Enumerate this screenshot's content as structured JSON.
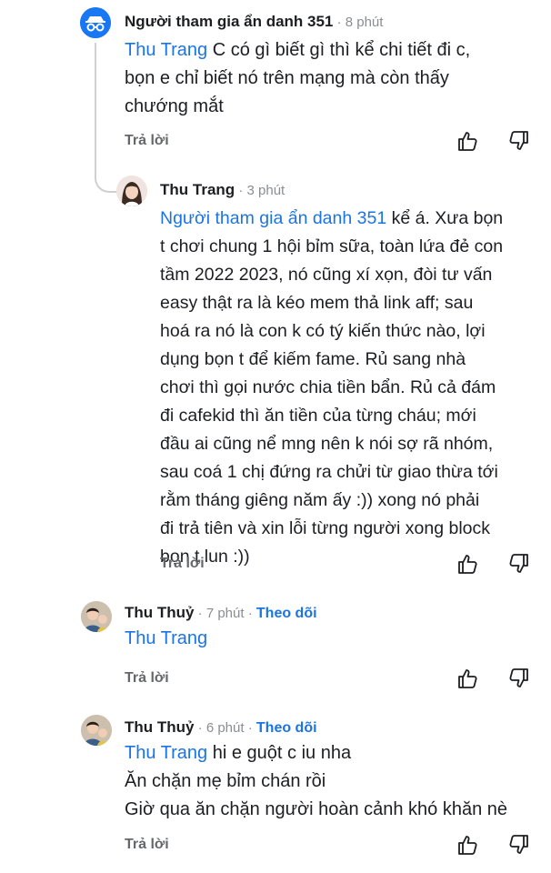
{
  "comments": [
    {
      "author": "Người tham gia ẩn danh 351",
      "time": "8 phút",
      "mention": "Thu Trang",
      "lines": [
        " C có gì biết gì thì kể chi tiết đi c,",
        "bọn e chỉ biết nó trên mạng mà còn thấy",
        "chướng mắt"
      ],
      "reply_label": "Trả lời",
      "avatar_icon": "anonymous-avatar-icon"
    },
    {
      "author": "Thu Trang",
      "time": "3 phút",
      "mention": "Người tham gia ẩn danh 351",
      "lines": [
        " kể á. Xưa bọn",
        "t chơi chung 1 hội bỉm sữa, toàn lứa đẻ con",
        "tầm 2022 2023, nó cũng xí xọn, đòi tư vấn",
        "easy thật ra là kéo mem thả link aff; sau",
        "hoá ra nó là con k có tý kiến thức nào, lợi",
        "dụng bọn t để kiếm fame. Rủ sang nhà",
        "chơi thì gọi nước chia tiền bẩn. Rủ cả đám",
        "đi cafekid thì ăn tiền của từng cháu; mới",
        "đầu ai cũng nể mng nên k nói sợ rã nhóm,",
        "sau coá 1 chị đứng ra chửi từ giao thừa tới",
        "rằm tháng giêng năm ấy :)) xong nó phải",
        "đi trả tiên và xin lỗi từng người xong block",
        "bọn t lun :))"
      ],
      "reply_label": "Trả lời"
    },
    {
      "author": "Thu Thuỷ",
      "time": "7 phút",
      "follow": "Theo dõi",
      "mention": "Thu Trang",
      "lines": [],
      "reply_label": "Trả lời"
    },
    {
      "author": "Thu Thuỷ",
      "time": "6 phút",
      "follow": "Theo dõi",
      "mention": "Thu Trang",
      "lines": [
        " hi e guột c iu nha",
        "Ăn chặn mẹ bỉm chán rồi",
        "Giờ qua ăn chặn người hoàn cảnh khó khăn nè"
      ],
      "reply_label": "Trả lời"
    }
  ],
  "separator": " · ",
  "icons": {
    "like": "thumbs-up-icon",
    "dislike": "thumbs-down-icon"
  },
  "colors": {
    "mention": "#1b74e4",
    "meta": "#8a8d91",
    "thread_line": "#ced0d4"
  }
}
